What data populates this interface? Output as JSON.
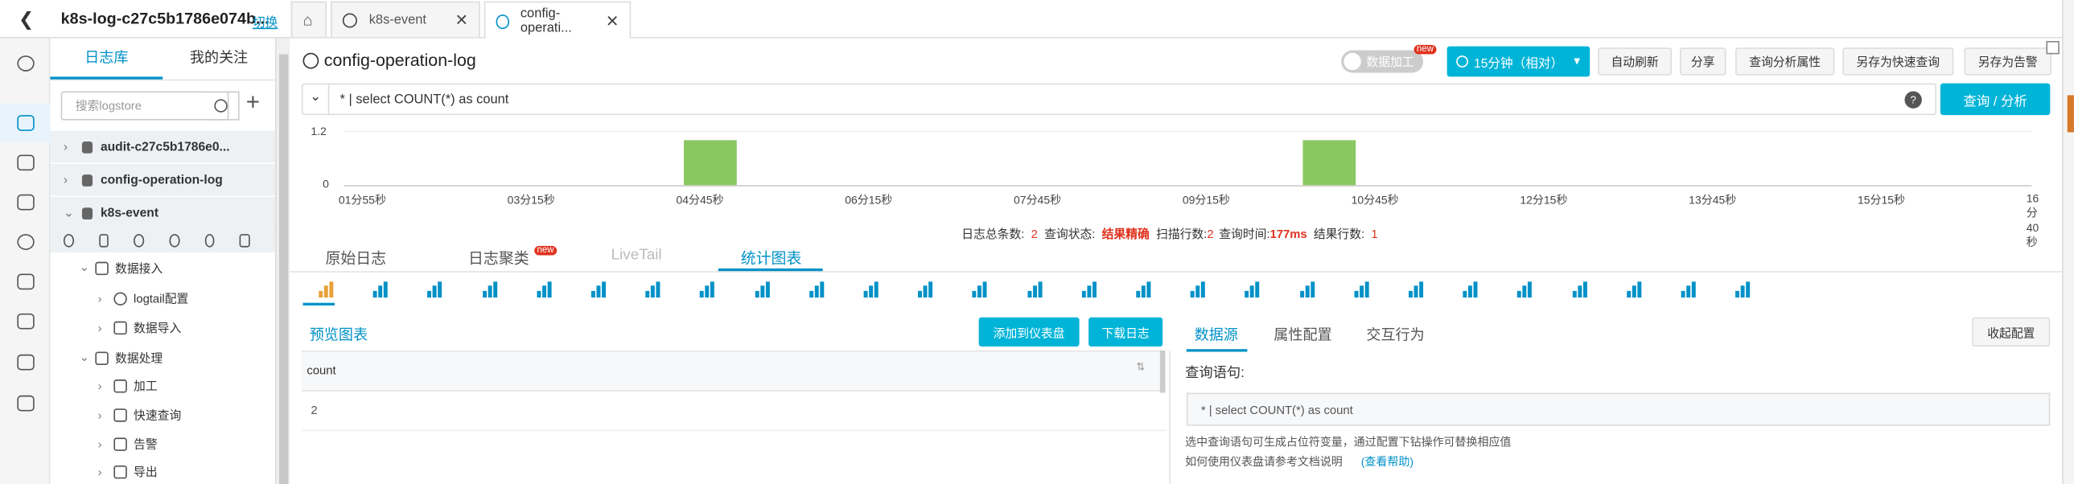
{
  "tabs": {
    "project": "k8s-log-c27c5b1786e074b...",
    "switch": "切换",
    "tab1": "k8s-event",
    "tab2": "config-operati..."
  },
  "sidebar": {
    "tab_store": "日志库",
    "tab_follow": "我的关注",
    "search_placeholder": "搜索logstore",
    "stores": [
      "audit-c27c5b1786e0...",
      "config-operation-log",
      "k8s-event"
    ],
    "nodes": [
      "数据接入",
      "logtail配置",
      "数据导入",
      "数据处理",
      "加工",
      "快速查询",
      "告警",
      "导出"
    ]
  },
  "header": {
    "title": "config-operation-log",
    "process_label": "数据加工",
    "new_badge": "new",
    "time_range": "15分钟（相对）",
    "buttons": [
      "自动刷新",
      "分享",
      "查询分析属性",
      "另存为快速查询",
      "另存为告警"
    ]
  },
  "query": {
    "text": "* | select COUNT(*) as count",
    "help": "?",
    "run": "查询 / 分析"
  },
  "histogram": {
    "ymax": "1.2",
    "ymin": "0",
    "ticks": [
      "01分55秒",
      "03分15秒",
      "04分45秒",
      "06分15秒",
      "07分45秒",
      "09分15秒",
      "10分45秒",
      "12分15秒",
      "13分45秒",
      "15分15秒",
      "16分40秒"
    ],
    "bars": [
      {
        "index": 6,
        "value": 1
      },
      {
        "index": 17,
        "value": 1
      }
    ]
  },
  "stats": {
    "l1": "日志总条数:",
    "v1": "2",
    "l2": "查询状态:",
    "v2": "结果精确",
    "l3": "扫描行数:",
    "v3": "2",
    "l4": "查询时间:",
    "v4": "177ms",
    "l5": "结果行数:",
    "v5": "1"
  },
  "resultTabs": {
    "raw": "原始日志",
    "cluster": "日志聚类",
    "new": "new",
    "livetail": "LiveTail",
    "chart": "统计图表"
  },
  "preview": {
    "title": "预览图表",
    "add_dashboard": "添加到仪表盘",
    "download": "下载日志",
    "column": "count",
    "value": "2"
  },
  "config": {
    "tab_data": "数据源",
    "tab_props": "属性配置",
    "tab_interact": "交互行为",
    "collapse": "收起配置",
    "query_label": "查询语句:",
    "query_text": "* | select COUNT(*) as count",
    "hint1": "选中查询语句可生成占位符变量，通过配置下钻操作可替换相应值",
    "hint2": "如何使用仪表盘请参考文档说明",
    "help_link": "(查看帮助)"
  }
}
